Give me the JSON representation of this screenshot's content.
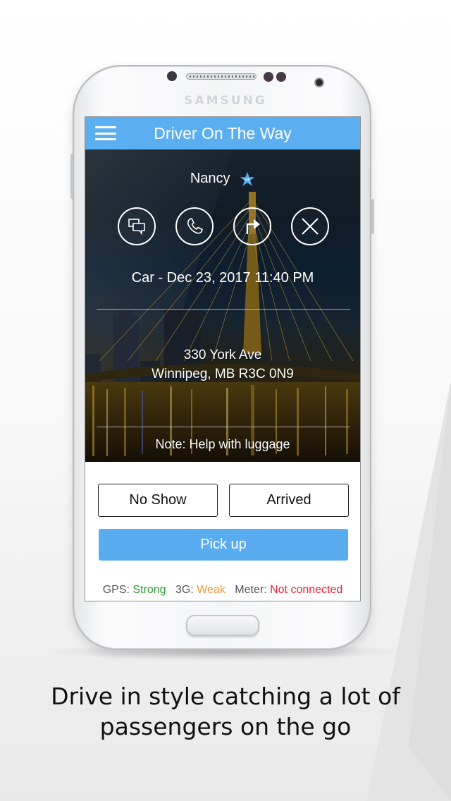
{
  "device": {
    "brand": "SAMSUNG"
  },
  "app_bar": {
    "menu_icon": "hamburger-menu-icon",
    "title": "Driver On The Way"
  },
  "trip": {
    "passenger_name": "Nancy",
    "vip_badge": {
      "icon": "vip-star-icon",
      "label": "VIP",
      "color": "#5baef0"
    },
    "actions": [
      {
        "id": "message",
        "icon": "chat-bubbles-icon"
      },
      {
        "id": "call",
        "icon": "phone-icon"
      },
      {
        "id": "navigate",
        "icon": "turn-right-arrow-icon"
      },
      {
        "id": "cancel",
        "icon": "close-x-icon"
      }
    ],
    "type_and_time": "Car - Dec 23, 2017 11:40 PM",
    "address_line1": "330 York Ave",
    "address_line2": "Winnipeg, MB R3C 0N9",
    "note": "Note: Help with luggage"
  },
  "buttons": {
    "no_show": "No Show",
    "arrived": "Arrived",
    "pick_up": "Pick up",
    "accent_color": "#59acf0"
  },
  "status": {
    "gps_label": "GPS:",
    "gps_value": "Strong",
    "gps_color": "#2e9a2e",
    "network_label": "3G:",
    "network_value": "Weak",
    "network_color": "#f0963a",
    "meter_label": "Meter:",
    "meter_value": "Not connected",
    "meter_color": "#e8203a"
  },
  "caption": {
    "line1": "Drive in style catching a lot of",
    "line2": "passengers on the go"
  }
}
